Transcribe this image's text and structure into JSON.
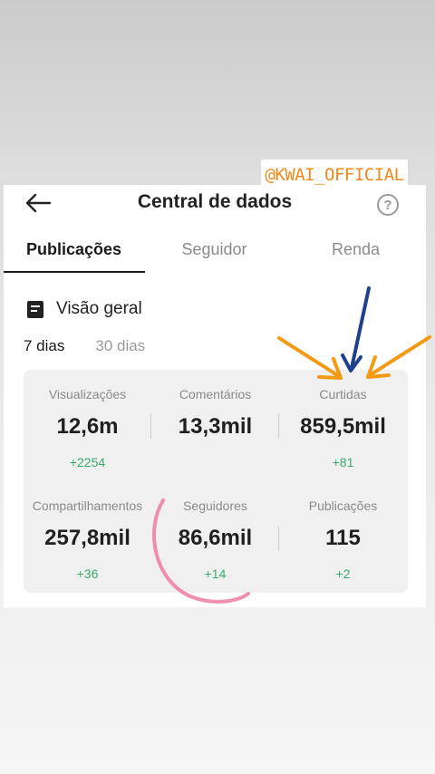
{
  "watermark": "@KWAI_OFFICIAL",
  "header": {
    "title": "Central de dados",
    "help_label": "?"
  },
  "tabs": [
    {
      "label": "Publicações",
      "active": true
    },
    {
      "label": "Seguidor",
      "active": false
    },
    {
      "label": "Renda",
      "active": false
    }
  ],
  "overview": {
    "title": "Visão geral",
    "periods": [
      {
        "label": "7 dias",
        "active": true
      },
      {
        "label": "30 dias",
        "active": false
      }
    ]
  },
  "stats": [
    {
      "label": "Visualizações",
      "value": "12,6m",
      "delta": "+2254"
    },
    {
      "label": "Comentários",
      "value": "13,3mil",
      "delta": ""
    },
    {
      "label": "Curtidas",
      "value": "859,5mil",
      "delta": "+81"
    },
    {
      "label": "Compartilhamentos",
      "value": "257,8mil",
      "delta": "+36"
    },
    {
      "label": "Seguidores",
      "value": "86,6mil",
      "delta": "+14"
    },
    {
      "label": "Publicações",
      "value": "115",
      "delta": "+2"
    }
  ],
  "colors": {
    "accent_orange": "#f29a14",
    "arrow_blue": "#1f3f8f",
    "positive_green": "#3aaa6a",
    "highlight_pink": "#ee7ca0"
  }
}
